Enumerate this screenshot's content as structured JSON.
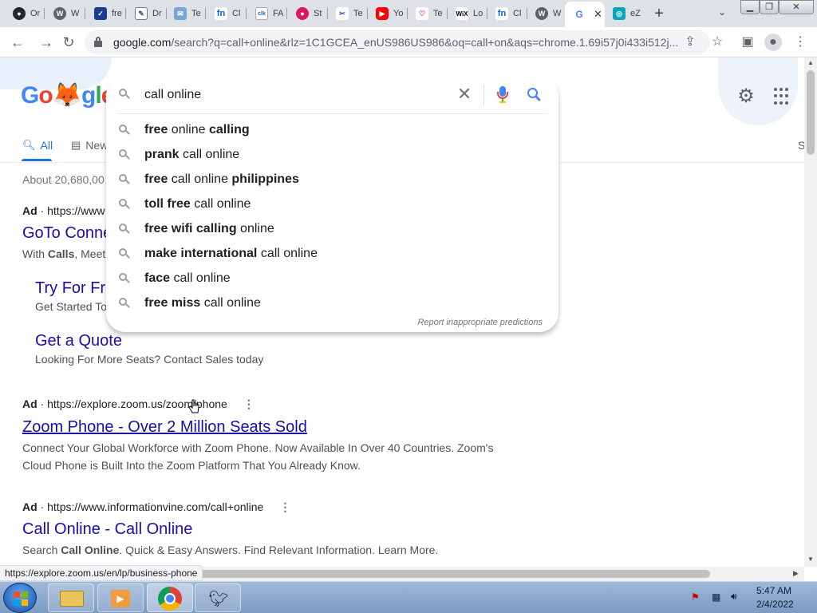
{
  "browser": {
    "tabs": [
      {
        "title": "Or",
        "icon": "github-icon"
      },
      {
        "title": "W",
        "icon": "wordpress-icon"
      },
      {
        "title": "fre",
        "icon": "shield-icon"
      },
      {
        "title": "Dr",
        "icon": "document-icon"
      },
      {
        "title": "Te",
        "icon": "mail-icon"
      },
      {
        "title": "Cl",
        "icon": "fn-icon"
      },
      {
        "title": "FA",
        "icon": "click-icon"
      },
      {
        "title": "St",
        "icon": "red-circle-icon"
      },
      {
        "title": "Te",
        "icon": "tools-icon"
      },
      {
        "title": "Yo",
        "icon": "youtube-icon"
      },
      {
        "title": "Te",
        "icon": "heart-icon"
      },
      {
        "title": "Lo",
        "icon": "wix-icon"
      },
      {
        "title": "Cl",
        "icon": "fn-icon"
      },
      {
        "title": "W",
        "icon": "wordpress-icon"
      },
      {
        "title": "",
        "icon": "google-icon",
        "active": true
      },
      {
        "title": "eZ",
        "icon": "ez-icon"
      }
    ],
    "new_tab": "+",
    "url_host": "google.com",
    "url_rest": "/search?q=call+online&rlz=1C1GCEA_enUS986US986&oq=call+on&aqs=chrome.1.69i57j0i433i512j..."
  },
  "search": {
    "query": "call online",
    "suggestions": [
      [
        {
          "t": "free",
          "b": true
        },
        {
          "t": " online ",
          "b": false
        },
        {
          "t": "calling",
          "b": true
        }
      ],
      [
        {
          "t": "prank",
          "b": true
        },
        {
          "t": " call online",
          "b": false
        }
      ],
      [
        {
          "t": "free",
          "b": true
        },
        {
          "t": " call online ",
          "b": false
        },
        {
          "t": "philippines",
          "b": true
        }
      ],
      [
        {
          "t": "toll free",
          "b": true
        },
        {
          "t": " call online",
          "b": false
        }
      ],
      [
        {
          "t": "free wifi calling",
          "b": true
        },
        {
          "t": " online",
          "b": false
        }
      ],
      [
        {
          "t": "make international",
          "b": true
        },
        {
          "t": " call online",
          "b": false
        }
      ],
      [
        {
          "t": "face",
          "b": true
        },
        {
          "t": " call online",
          "b": false
        }
      ],
      [
        {
          "t": "free miss",
          "b": true
        },
        {
          "t": " call online",
          "b": false
        }
      ]
    ],
    "report": "Report inappropriate predictions"
  },
  "tabs_row": {
    "all": "All",
    "news": "New",
    "right_fragment": "S"
  },
  "results": {
    "about": "About 20,680,00",
    "ad1": {
      "ad": "Ad",
      "url": "https://www",
      "title": "GoTo Conne",
      "snippet_bold": "Calls",
      "snippet_pre": "With ",
      "snippet_post": ", Meeti"
    },
    "sitelinks": [
      {
        "title": "Try For Fre",
        "snippet": "Get Started To"
      },
      {
        "title": "Get a Quote",
        "snippet": "Looking For More Seats? Contact Sales today"
      }
    ],
    "ad2": {
      "ad": "Ad",
      "url": "https://explore.zoom.us/zoom/phone",
      "title": "Zoom Phone - Over 2 Million Seats Sold",
      "snippet": "Connect Your Global Workforce with Zoom Phone. Now Available In Over 40 Countries. Zoom's Cloud Phone is Built Into the Zoom Platform That You Already Know."
    },
    "ad3": {
      "ad": "Ad",
      "url": "https://www.informationvine.com/call+online",
      "title": "Call Online - Call Online",
      "snippet_pre": "Search ",
      "snippet_bold": "Call Online",
      "snippet_post": ". Quick & Easy Answers. Find Relevant Information. Learn More."
    }
  },
  "status_url": "https://explore.zoom.us/en/lp/business-phone",
  "taskbar": {
    "time": "5:47 AM",
    "date": "2/4/2022"
  },
  "colors": {
    "link": "#1a0dab",
    "accent": "#1a73e8"
  }
}
